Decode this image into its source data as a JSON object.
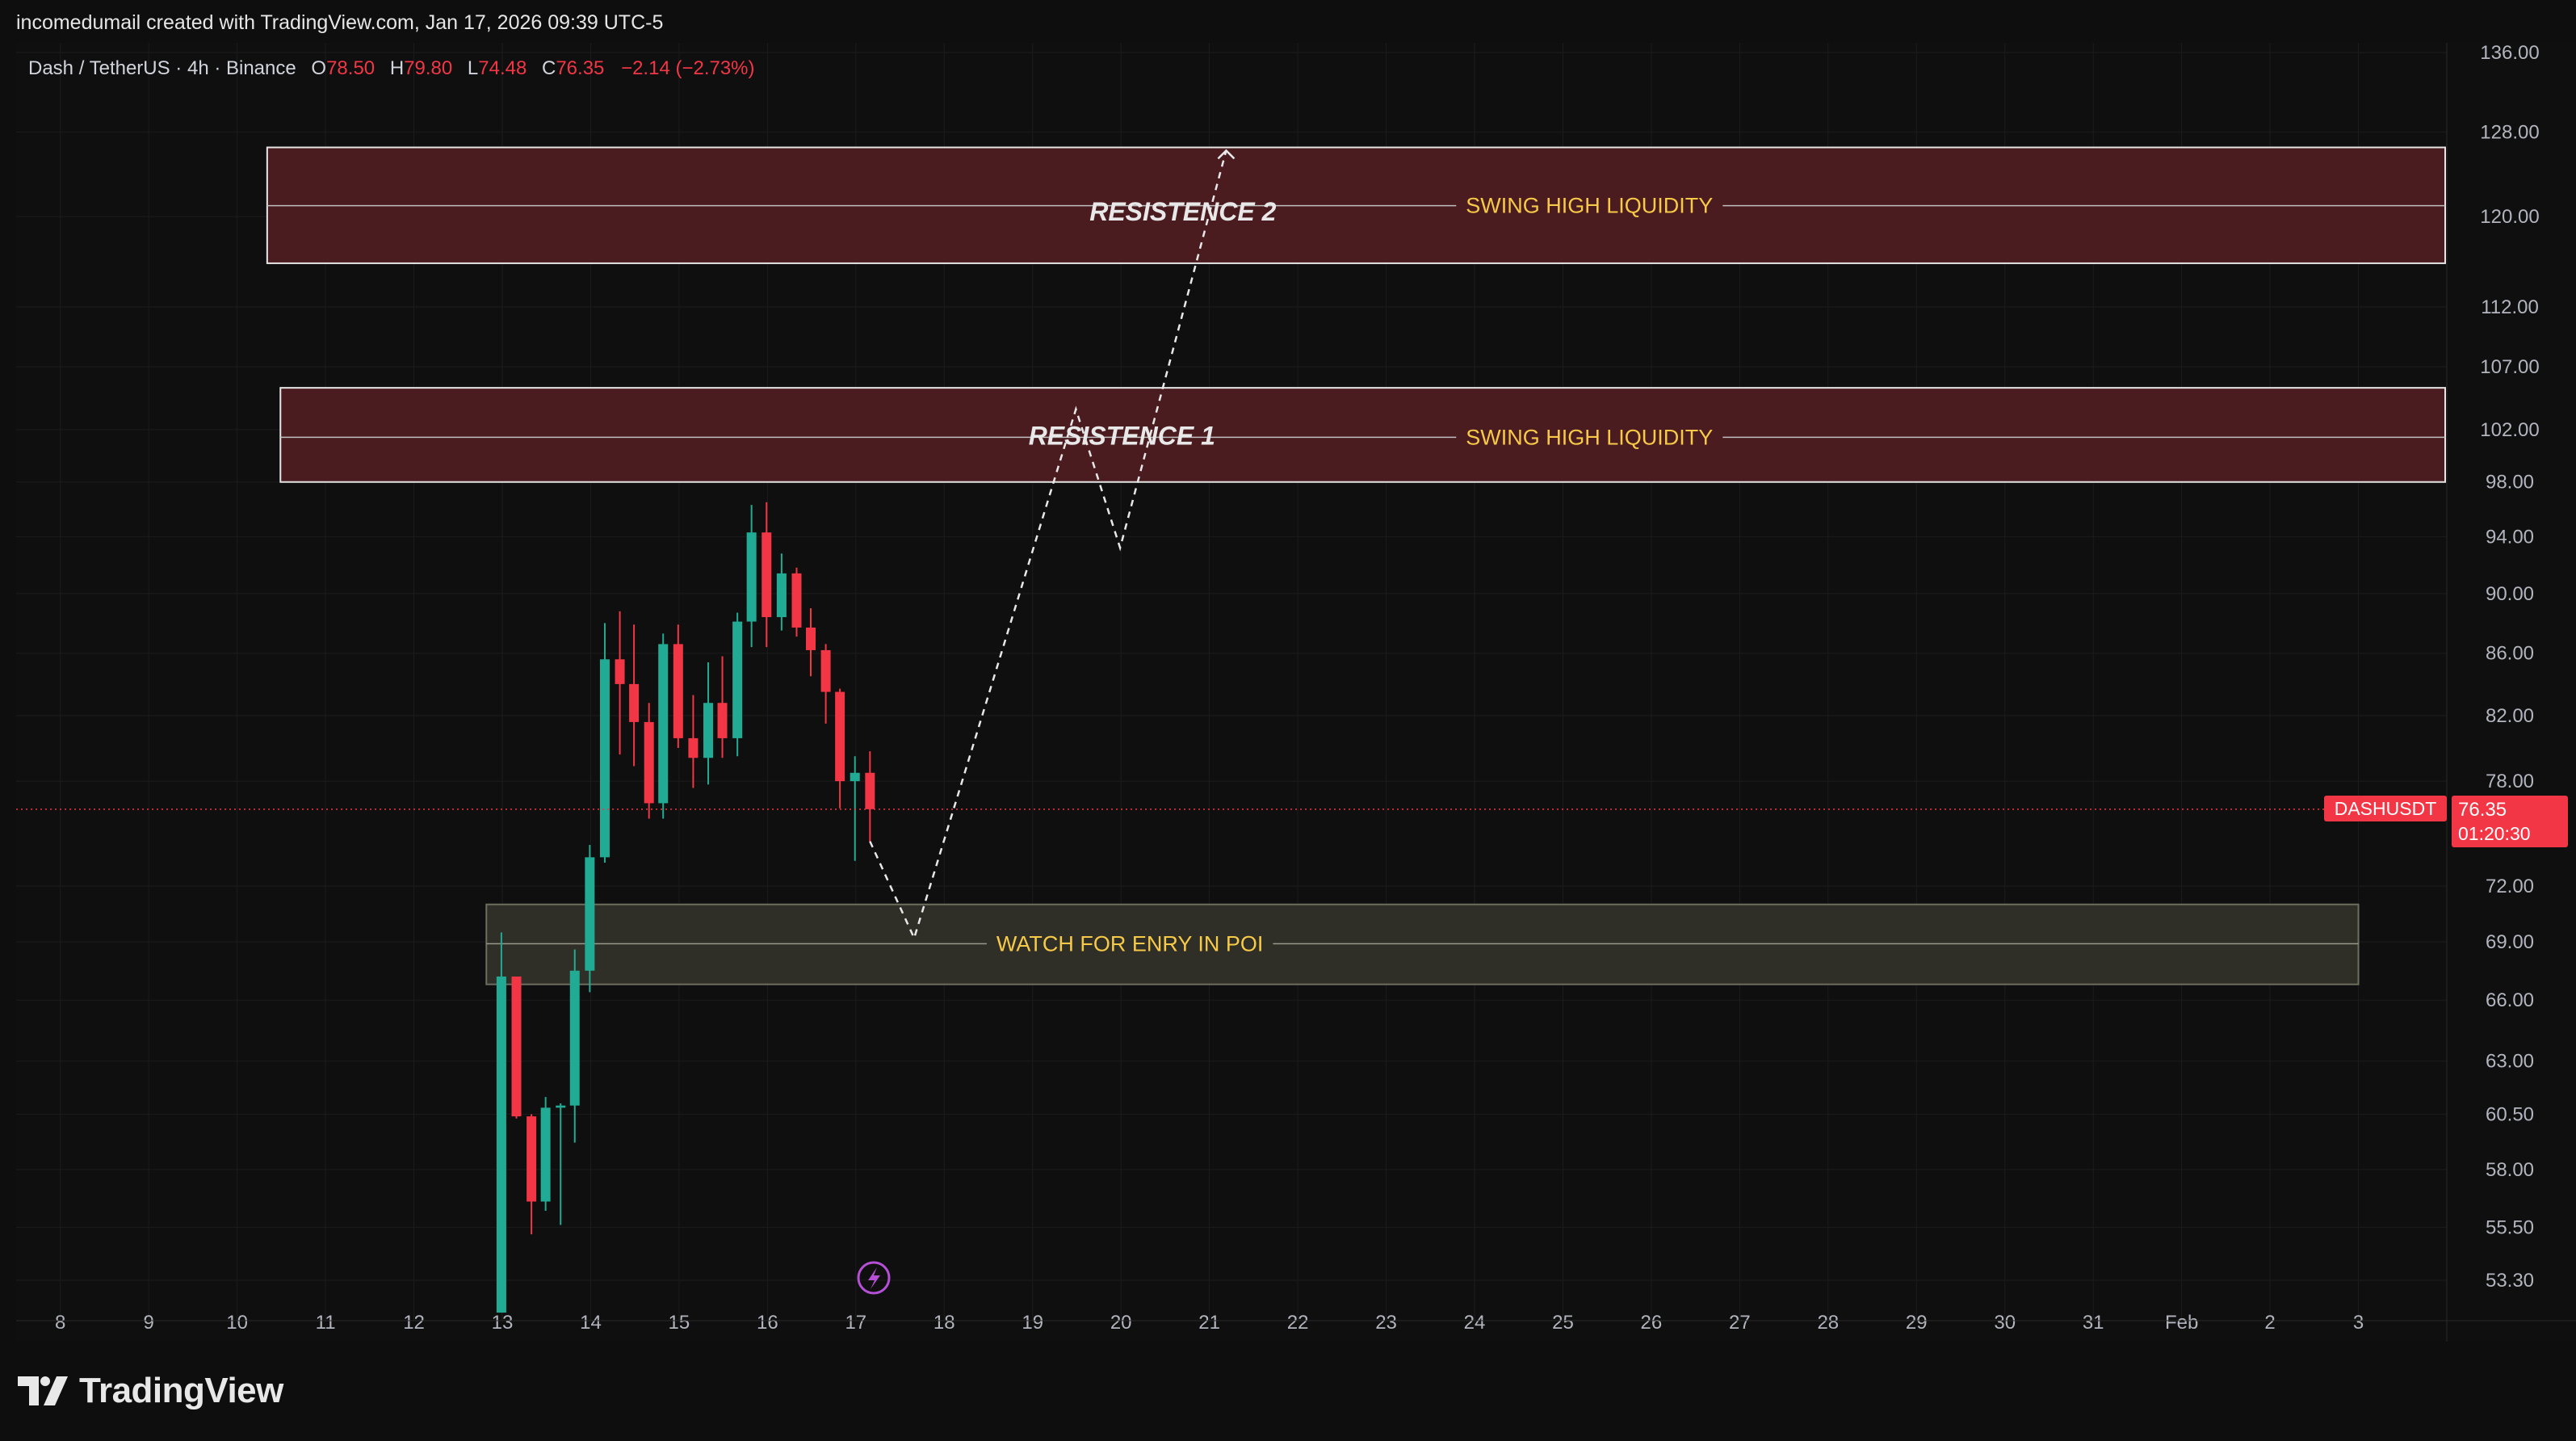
{
  "header": {
    "credit": "incomedumail created with TradingView.com, Jan 17, 2026 09:39 UTC-5"
  },
  "legend": {
    "symbol": "Dash / TetherUS · 4h · Binance",
    "o_label": "O",
    "o_value": "78.50",
    "h_label": "H",
    "h_value": "79.80",
    "l_label": "L",
    "l_value": "74.48",
    "c_label": "C",
    "c_value": "76.35",
    "change": "−2.14 (−2.73%)"
  },
  "price_tag": {
    "ticker": "DASHUSDT",
    "price": "76.35",
    "countdown": "01:20:30"
  },
  "footer": {
    "brand": "TradingView"
  },
  "colors": {
    "background": "#0f0f0f",
    "up": "#22ab94",
    "down": "#f23645",
    "resistance_fill": "#4a1b1f",
    "poi_fill": "#2f2f28",
    "annotation_text": "#f7c948",
    "axis_text": "#b2b5be",
    "price_line": "#f23645"
  },
  "chart_data": {
    "type": "candlestick",
    "symbol": "DASHUSDT",
    "interval": "4h",
    "y_axis": {
      "scale": "log",
      "ticks": [
        136.0,
        128.0,
        120.0,
        112.0,
        107.0,
        102.0,
        98.0,
        94.0,
        90.0,
        86.0,
        82.0,
        78.0,
        72.0,
        69.0,
        66.0,
        63.0,
        60.5,
        58.0,
        55.5,
        53.3
      ],
      "tick_labels": [
        "136.00",
        "128.00",
        "120.00",
        "112.00",
        "107.00",
        "102.00",
        "98.00",
        "94.00",
        "90.00",
        "86.00",
        "82.00",
        "78.00",
        "72.00",
        "69.00",
        "66.00",
        "63.00",
        "60.50",
        "58.00",
        "55.50",
        "53.30"
      ]
    },
    "x_axis": {
      "labels": [
        "8",
        "9",
        "10",
        "11",
        "12",
        "13",
        "14",
        "15",
        "16",
        "17",
        "18",
        "19",
        "20",
        "21",
        "22",
        "23",
        "24",
        "25",
        "26",
        "27",
        "28",
        "29",
        "30",
        "31",
        "Feb",
        "2",
        "3"
      ],
      "label_days": [
        8,
        9,
        10,
        11,
        12,
        13,
        14,
        15,
        16,
        17,
        18,
        19,
        20,
        21,
        22,
        23,
        24,
        25,
        26,
        27,
        28,
        29,
        30,
        31,
        32,
        33,
        34
      ],
      "range_days": [
        7.5,
        35.0
      ]
    },
    "candles": [
      {
        "t": 12.99,
        "o": 52.0,
        "h": 69.5,
        "l": 52.0,
        "c": 67.2
      },
      {
        "t": 13.16,
        "o": 67.2,
        "h": 67.2,
        "l": 60.3,
        "c": 60.4
      },
      {
        "t": 13.33,
        "o": 60.4,
        "h": 60.5,
        "l": 55.2,
        "c": 56.6
      },
      {
        "t": 13.49,
        "o": 56.6,
        "h": 61.3,
        "l": 56.2,
        "c": 60.8
      },
      {
        "t": 13.66,
        "o": 60.8,
        "h": 61.0,
        "l": 55.6,
        "c": 60.9
      },
      {
        "t": 13.82,
        "o": 60.9,
        "h": 68.6,
        "l": 59.2,
        "c": 67.5
      },
      {
        "t": 13.99,
        "o": 67.5,
        "h": 74.3,
        "l": 66.4,
        "c": 73.6
      },
      {
        "t": 14.16,
        "o": 73.6,
        "h": 88.0,
        "l": 73.3,
        "c": 85.6
      },
      {
        "t": 14.33,
        "o": 85.6,
        "h": 88.8,
        "l": 79.6,
        "c": 84.0
      },
      {
        "t": 14.49,
        "o": 84.0,
        "h": 87.9,
        "l": 78.9,
        "c": 81.6
      },
      {
        "t": 14.66,
        "o": 81.6,
        "h": 82.8,
        "l": 75.8,
        "c": 76.7
      },
      {
        "t": 14.82,
        "o": 76.7,
        "h": 87.3,
        "l": 75.8,
        "c": 86.6
      },
      {
        "t": 14.99,
        "o": 86.6,
        "h": 87.9,
        "l": 80.0,
        "c": 80.6
      },
      {
        "t": 15.16,
        "o": 80.6,
        "h": 83.3,
        "l": 77.6,
        "c": 79.4
      },
      {
        "t": 15.33,
        "o": 79.4,
        "h": 85.4,
        "l": 77.8,
        "c": 82.8
      },
      {
        "t": 15.49,
        "o": 82.8,
        "h": 85.8,
        "l": 79.4,
        "c": 80.6
      },
      {
        "t": 15.66,
        "o": 80.6,
        "h": 88.7,
        "l": 79.5,
        "c": 88.1
      },
      {
        "t": 15.82,
        "o": 88.1,
        "h": 96.3,
        "l": 86.4,
        "c": 94.3
      },
      {
        "t": 15.99,
        "o": 94.3,
        "h": 96.5,
        "l": 86.4,
        "c": 88.4
      },
      {
        "t": 16.16,
        "o": 88.4,
        "h": 92.8,
        "l": 87.5,
        "c": 91.4
      },
      {
        "t": 16.33,
        "o": 91.4,
        "h": 91.8,
        "l": 87.1,
        "c": 87.7
      },
      {
        "t": 16.49,
        "o": 87.7,
        "h": 89.0,
        "l": 84.5,
        "c": 86.2
      },
      {
        "t": 16.66,
        "o": 86.2,
        "h": 86.6,
        "l": 81.5,
        "c": 83.5
      },
      {
        "t": 16.82,
        "o": 83.5,
        "h": 83.7,
        "l": 76.4,
        "c": 78.0
      },
      {
        "t": 16.99,
        "o": 78.0,
        "h": 79.5,
        "l": 73.4,
        "c": 78.5
      },
      {
        "t": 17.16,
        "o": 78.5,
        "h": 79.8,
        "l": 74.48,
        "c": 76.35
      }
    ],
    "last_price": 76.35,
    "zones": [
      {
        "label": "RESISTENCE 2",
        "side_label": "SWING HIGH LIQUIDITY",
        "x_start": 10.34,
        "top": 126.5,
        "bottom": 115.8,
        "mid": 121.0,
        "kind": "resistance"
      },
      {
        "label": "RESISTENCE 1",
        "side_label": "SWING HIGH LIQUIDITY",
        "x_start": 10.49,
        "top": 105.3,
        "bottom": 98.0,
        "mid": 101.4,
        "kind": "resistance"
      },
      {
        "label": "",
        "side_label": "WATCH FOR ENRY IN POI",
        "x_start": 12.82,
        "x_end": 34.0,
        "top": 71.0,
        "bottom": 66.8,
        "mid": 68.9,
        "kind": "poi"
      }
    ],
    "projection_path": [
      {
        "t": 17.16,
        "p": 74.5
      },
      {
        "t": 17.66,
        "p": 69.2
      },
      {
        "t": 19.49,
        "p": 103.6
      },
      {
        "t": 19.99,
        "p": 93.2
      },
      {
        "t": 21.19,
        "p": 126.2
      }
    ]
  }
}
